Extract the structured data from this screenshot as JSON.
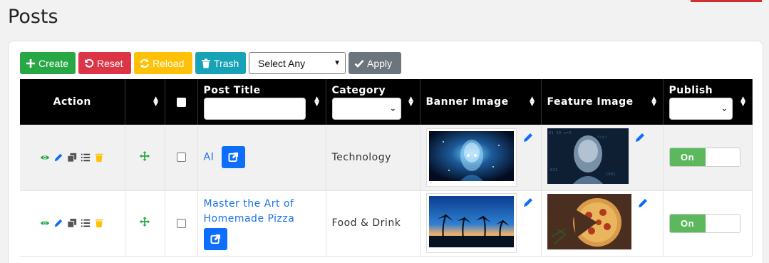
{
  "page": {
    "title": "Posts"
  },
  "toolbar": {
    "create_label": "Create",
    "reset_label": "Reset",
    "reload_label": "Reload",
    "trash_label": "Trash",
    "bulk_select_value": "Select Any",
    "apply_label": "Apply"
  },
  "table": {
    "headers": {
      "action": "Action",
      "post_title": "Post Title",
      "category": "Category",
      "banner_image": "Banner Image",
      "feature_image": "Feature Image",
      "publish": "Publish"
    },
    "rows": [
      {
        "title": "AI",
        "category": "Technology",
        "publish": "On"
      },
      {
        "title": "Master the Art of Homemade Pizza",
        "category": "Food & Drink",
        "publish": "On"
      }
    ]
  },
  "colors": {
    "create": "#28a745",
    "reset": "#dc3545",
    "reload": "#ffc107",
    "trash": "#17a2b8",
    "apply": "#6c757d",
    "header_bg": "#000000",
    "toggle_on": "#5cb85c",
    "link": "#1a73e8"
  },
  "icons": {
    "row_actions": [
      "eye-icon",
      "pencil-icon",
      "copy-icon",
      "list-icon",
      "trash-icon"
    ],
    "reorder": "move-icon",
    "external_link": "external-link-icon",
    "edit_image": "pencil-icon"
  }
}
